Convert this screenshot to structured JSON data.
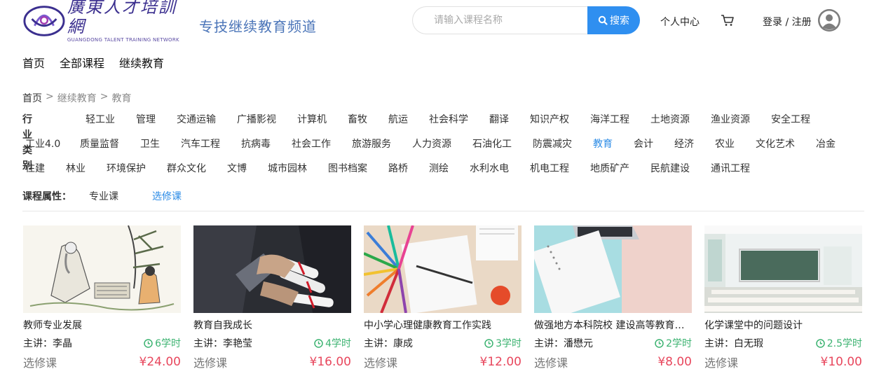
{
  "header": {
    "logo_cn": "廣東人才培訓網",
    "logo_en": "GUANGDONG TALENT TRAINING NETWORK",
    "channel": "专技继续教育频道",
    "search_placeholder": "请输入课程名称",
    "search_button": "搜索",
    "personal_center": "个人中心",
    "login": "登录 / 注册",
    "accent_color": "#2f8ff0"
  },
  "nav": [
    "首页",
    "全部课程",
    "继续教育"
  ],
  "breadcrumb": {
    "home": "首页",
    "sep": ">",
    "level1": "继续教育",
    "level2": "教育"
  },
  "categories": {
    "label": "行业类别",
    "row1": [
      "轻工业",
      "管理",
      "交通运输",
      "广播影视",
      "计算机",
      "畜牧",
      "航运",
      "社会科学",
      "翻译",
      "知识产权",
      "海洋工程",
      "土地资源",
      "渔业资源",
      "安全工程"
    ],
    "row2": [
      "工业4.0",
      "质量监督",
      "卫生",
      "汽车工程",
      "抗病毒",
      "社会工作",
      "旅游服务",
      "人力资源",
      "石油化工",
      "防震减灾",
      "教育",
      "会计",
      "经济",
      "农业",
      "文化艺术",
      "冶金"
    ],
    "row3": [
      "住建",
      "林业",
      "环境保护",
      "群众文化",
      "文博",
      "城市园林",
      "图书档案",
      "路桥",
      "测绘",
      "水利水电",
      "机电工程",
      "地质矿产",
      "民航建设",
      "通讯工程"
    ],
    "active": "教育"
  },
  "attributes": {
    "label": "课程属性：",
    "items": [
      "专业课",
      "选修课"
    ],
    "active": "选修课"
  },
  "courses": [
    {
      "title": "教师专业发展",
      "teacher": "主讲：李晶",
      "hours": "6学时",
      "type": "选修课",
      "price": "¥24.00"
    },
    {
      "title": "教育自我成长",
      "teacher": "主讲：李艳莹",
      "hours": "4学时",
      "type": "选修课",
      "price": "¥16.00"
    },
    {
      "title": "中小学心理健康教育工作实践",
      "teacher": "主讲：康成",
      "hours": "3学时",
      "type": "选修课",
      "price": "¥12.00"
    },
    {
      "title": "做强地方本科院校 建设高等教育强...",
      "teacher": "主讲：潘懋元",
      "hours": "2学时",
      "type": "选修课",
      "price": "¥8.00"
    },
    {
      "title": "化学课堂中的问题设计",
      "teacher": "主讲：白无瑕",
      "hours": "2.5学时",
      "type": "选修课",
      "price": "¥10.00"
    }
  ]
}
